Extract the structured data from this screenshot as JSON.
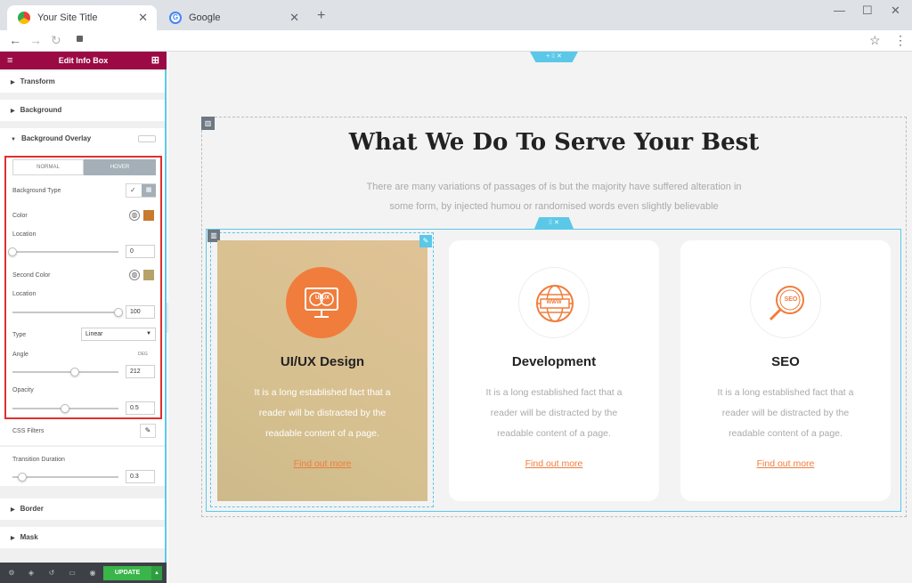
{
  "browser": {
    "tabs": [
      {
        "title": "Your Site Title"
      },
      {
        "title": "Google"
      }
    ],
    "new_tab": "+",
    "controls": [
      "—",
      "☐",
      "✕"
    ]
  },
  "panel": {
    "title": "Edit Info Box",
    "sections": {
      "transform": "Transform",
      "background": "Background",
      "background_overlay": "Background Overlay",
      "border": "Border",
      "mask": "Mask"
    },
    "overlay": {
      "tabs": {
        "normal": "NORMAL",
        "hover": "HOVER"
      },
      "background_type": "Background Type",
      "color": "Color",
      "color_value": "#c77a2e",
      "location": "Location",
      "location_value": "0",
      "second_color": "Second Color",
      "second_color_value": "#b7a36a",
      "location2": "Location",
      "location2_value": "100",
      "type": "Type",
      "type_value": "Linear",
      "angle": "Angle",
      "angle_unit": "DEG",
      "angle_value": "212",
      "opacity": "Opacity",
      "opacity_value": "0.5"
    },
    "css_filters": "CSS Filters",
    "transition_duration": "Transition Duration",
    "transition_value": "0.3",
    "update": "UPDATE",
    "slider_levels": {
      "location": 0,
      "location2": 1,
      "angle": 0.59,
      "opacity": 0.5,
      "transition": 0.1
    }
  },
  "page": {
    "heading": "What We Do To Serve Your Best",
    "subheading_line1": "There are many variations of passages of is but the majority have suffered alteration in",
    "subheading_line2": "some form, by injected humou or randomised words even slightly believable",
    "cards": [
      {
        "title": "UI/UX Design",
        "icon_text": "UI UX",
        "body": [
          "It is a long established fact that a",
          "reader will be distracted by the",
          "readable content of a page."
        ],
        "link": "Find out more"
      },
      {
        "title": "Development",
        "icon_text": "WWW",
        "body": [
          "It is a long established fact that a",
          "reader will be distracted by the",
          "readable content of a page."
        ],
        "link": "Find out more"
      },
      {
        "title": "SEO",
        "icon_text": "SEO",
        "body": [
          "It is a long established fact that a",
          "reader will be distracted by the",
          "readable content of a page."
        ],
        "link": "Find out more"
      }
    ]
  },
  "colors": {
    "accent": "#f07d3c",
    "brand": "#9b0a44",
    "selection": "#5bc8e8",
    "update": "#39b54a"
  }
}
